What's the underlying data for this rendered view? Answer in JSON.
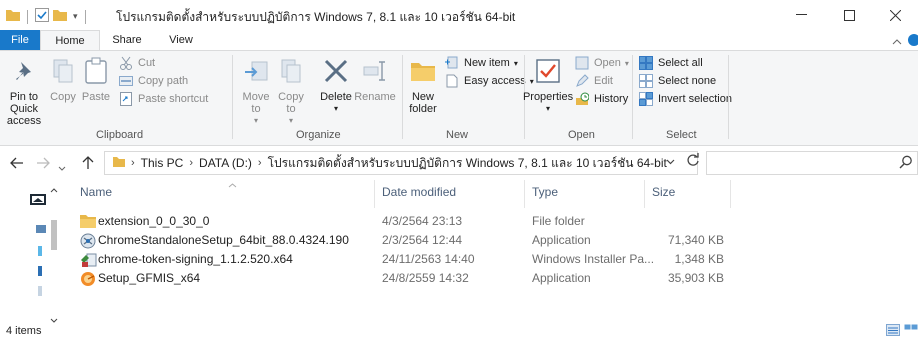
{
  "window": {
    "title": "โปรแกรมติดตั้งสำหรับระบบปฏิบัติการ Windows 7, 8.1 และ 10 เวอร์ชัน 64-bit",
    "controls": {
      "minimize": "—",
      "maximize": "☐",
      "close": "✕"
    }
  },
  "ribbon_tabs": [
    "File",
    "Home",
    "Share",
    "View"
  ],
  "ribbon": {
    "clipboard": {
      "label": "Clipboard",
      "pin": "Pin to Quick access",
      "copy": "Copy",
      "paste": "Paste",
      "cut": "Cut",
      "copy_path": "Copy path",
      "paste_shortcut": "Paste shortcut"
    },
    "organize": {
      "label": "Organize",
      "move_to": "Move to",
      "copy_to": "Copy to",
      "delete": "Delete",
      "rename": "Rename"
    },
    "new": {
      "label": "New",
      "new_folder": "New folder",
      "new_item": "New item",
      "easy_access": "Easy access"
    },
    "open": {
      "label": "Open",
      "properties": "Properties",
      "open": "Open",
      "edit": "Edit",
      "history": "History"
    },
    "select": {
      "label": "Select",
      "select_all": "Select all",
      "select_none": "Select none",
      "invert": "Invert selection"
    }
  },
  "address": {
    "crumbs": [
      "This PC",
      "DATA (D:)",
      "โปรแกรมติดตั้งสำหรับระบบปฏิบัติการ Windows 7, 8.1 และ 10 เวอร์ชัน 64-bit"
    ],
    "search_placeholder": ""
  },
  "columns": {
    "name": "Name",
    "date": "Date modified",
    "type": "Type",
    "size": "Size"
  },
  "files": [
    {
      "name": "extension_0_0_30_0",
      "date": "4/3/2564 23:13",
      "type": "File folder",
      "size": "",
      "icon": "folder-icon"
    },
    {
      "name": "ChromeStandaloneSetup_64bit_88.0.4324.190",
      "date": "2/3/2564 12:44",
      "type": "Application",
      "size": "71,340 KB",
      "icon": "installer-icon"
    },
    {
      "name": "chrome-token-signing_1.1.2.520.x64",
      "date": "24/11/2563 14:40",
      "type": "Windows Installer Pa...",
      "size": "1,348 KB",
      "icon": "msi-package-icon"
    },
    {
      "name": "Setup_GFMIS_x64",
      "date": "24/8/2559 14:32",
      "type": "Application",
      "size": "35,903 KB",
      "icon": "gfmis-app-icon"
    }
  ],
  "status": {
    "item_count": "4 items"
  },
  "colors": {
    "accent": "#1979ca",
    "ribbon_bg": "#f5f6f7",
    "folder": "#e8b84a",
    "header_text": "#4c607a"
  }
}
